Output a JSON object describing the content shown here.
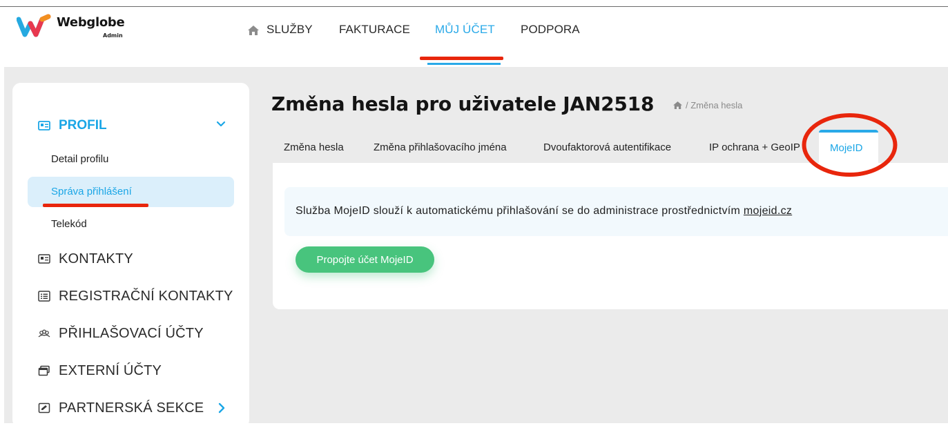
{
  "header": {
    "logo": {
      "brand": "Webglobe",
      "sub": "Admin"
    },
    "nav": [
      {
        "label": "SLUŽBY",
        "icon": "home-icon"
      },
      {
        "label": "FAKTURACE"
      },
      {
        "label": "MŮJ ÚČET",
        "active": true
      },
      {
        "label": "PODPORA"
      }
    ]
  },
  "sidebar": {
    "profile": {
      "label": "PROFIL",
      "icon": "id-card-icon"
    },
    "profile_items": [
      {
        "label": "Detail profilu"
      },
      {
        "label": "Správa přihlášení",
        "active": true
      },
      {
        "label": "Telekód"
      }
    ],
    "sections": [
      {
        "label": "KONTAKTY",
        "icon": "id-card-icon"
      },
      {
        "label": "REGISTRAČNÍ KONTAKTY",
        "icon": "list-icon"
      },
      {
        "label": "PŘIHLAŠOVACÍ ÚČTY",
        "icon": "users-icon"
      },
      {
        "label": "EXTERNÍ ÚČTY",
        "icon": "window-stack-icon"
      },
      {
        "label": "PARTNERSKÁ SEKCE",
        "icon": "edit-icon"
      }
    ]
  },
  "page": {
    "title": "Změna hesla pro uživatele JAN2518",
    "breadcrumb": "/ Změna hesla",
    "tabs": [
      {
        "label": "Změna hesla"
      },
      {
        "label": "Změna přihlašovacího jména"
      },
      {
        "label": "Dvoufaktorová autentifikace"
      },
      {
        "label": "IP ochrana + GeoIP"
      },
      {
        "label": "MojeID",
        "active": true
      }
    ],
    "info_text": "Služba MojeID slouží k automatickému přihlašování se do administrace prostřednictvím",
    "info_link": "mojeid.cz",
    "button_label": "Propojte účet MojeID"
  },
  "colors": {
    "accent": "#29a9e8",
    "button": "#48c47d",
    "annotation": "#e8260c",
    "background": "#ebebeb"
  }
}
